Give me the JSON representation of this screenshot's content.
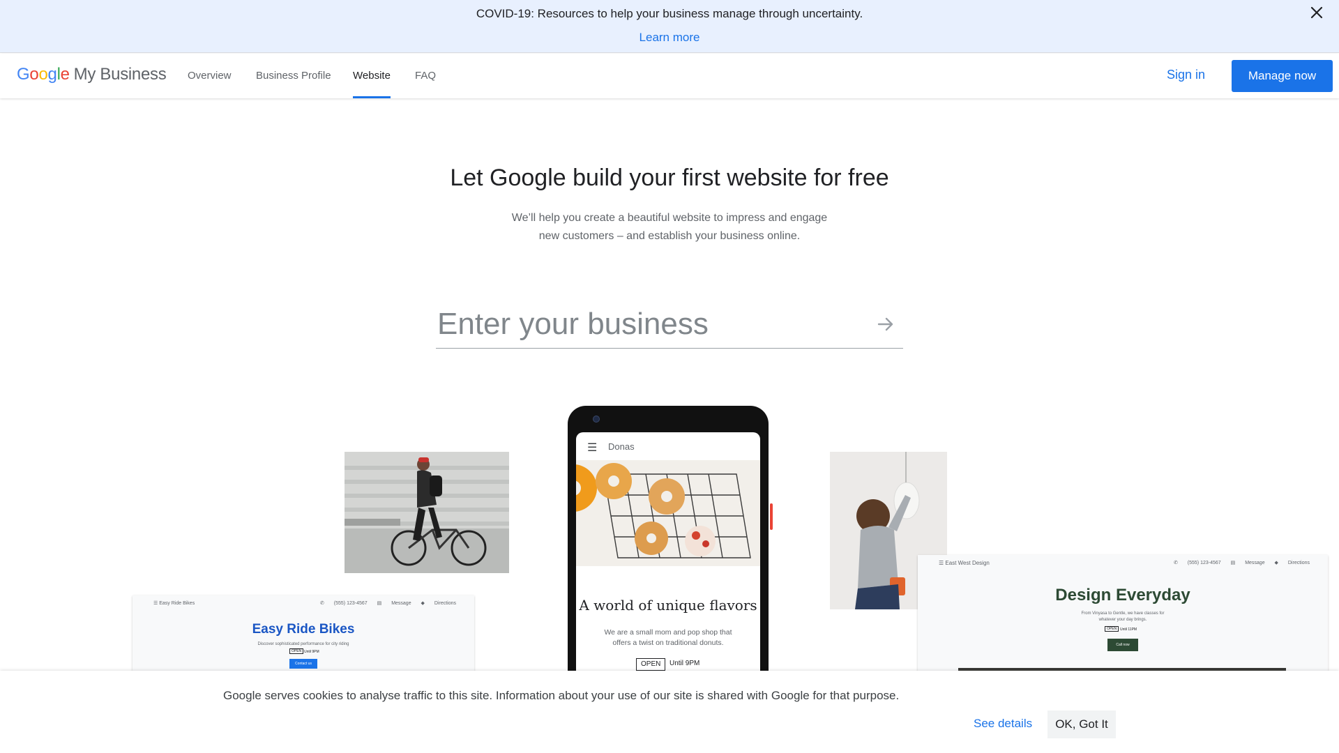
{
  "banner": {
    "text": "COVID-19: Resources to help your business manage through uncertainty.",
    "link": "Learn more",
    "close_icon": "close-icon"
  },
  "nav": {
    "logo_google": [
      "G",
      "o",
      "o",
      "g",
      "l",
      "e"
    ],
    "logo_product": "My Business",
    "tabs": [
      {
        "label": "Overview",
        "active": false
      },
      {
        "label": "Business Profile",
        "active": false
      },
      {
        "label": "Website",
        "active": true
      },
      {
        "label": "FAQ",
        "active": false
      }
    ],
    "sign_in": "Sign in",
    "manage_now": "Manage now"
  },
  "hero": {
    "title": "Let Google build your first website for free",
    "subtitle_line1": "We’ll help you create a beautiful website to impress and engage",
    "subtitle_line2": "new customers – and establish your business online.",
    "search_placeholder": "Enter your business",
    "submit_icon": "arrow-right-icon"
  },
  "phone": {
    "brand": "Donas",
    "menu_icon": "menu-icon",
    "headline": "A world of unique flavors",
    "description": "We are a small mom and pop shop that offers a twist on traditional donuts.",
    "open_badge": "OPEN",
    "hours": "Until 9PM"
  },
  "mini_left": {
    "brand": "Easy Ride Bikes",
    "phone": "(555) 123-4567",
    "message": "Message",
    "directions": "Directions",
    "title": "Easy Ride Bikes",
    "subtitle": "Discover sophisticated performance for city riding",
    "open_badge": "OPEN",
    "hours": "Until 9PM",
    "cta": "Contact us",
    "accent": "#1a56c4"
  },
  "mini_right": {
    "brand": "East West Design",
    "phone": "(555) 123-4567",
    "message": "Message",
    "directions": "Directions",
    "title": "Design Everyday",
    "subtitle_line1": "From Vinyasa to Gentle, we have classes for",
    "subtitle_line2": "whatever your day brings.",
    "open_badge": "OPEN",
    "hours": "Until 11PM",
    "cta": "Call now",
    "accent": "#2d4a34"
  },
  "cookie": {
    "text": "Google serves cookies to analyse traffic to this site. Information about your use of our site is shared with Google for that purpose.",
    "details": "See details",
    "ok": "OK, Got It"
  },
  "colors": {
    "primary": "#1a73e8",
    "banner_bg": "#e8f0fe"
  }
}
